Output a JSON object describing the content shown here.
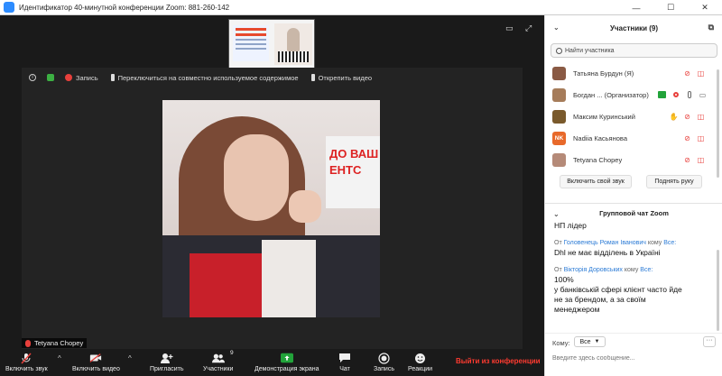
{
  "window": {
    "title": "Идентификатор 40-минутной конференции Zoom: 881-260-142",
    "controls": [
      "—",
      "☐",
      "✕"
    ]
  },
  "video_bar": {
    "record_label": "Запись",
    "switch_label": "Переключиться на совместно используемое содержимое",
    "pin_label": "Открепить видео"
  },
  "thumbnail": {
    "slide_text": "Електронний оборот"
  },
  "video_photo": {
    "sign_line1": "ДО ВАШ",
    "sign_line2": "ЕНТС"
  },
  "name_tag": "Tetyana Chopey",
  "toolbar": {
    "mute": "Включить звук",
    "video": "Включить видео",
    "invite": "Пригласить",
    "participants": "Участники",
    "participants_count": "9",
    "share": "Демонстрация экрана",
    "chat": "Чат",
    "record": "Запись",
    "reactions": "Реакции",
    "end": "Выйти из конференции"
  },
  "sidebar": {
    "participants_header": "Участники (9)",
    "search_placeholder": "Найти участника",
    "participants": [
      {
        "name": "Татьяна Бурдун (Я)",
        "avatar_color": "#8a5a44",
        "avatar_text": ""
      },
      {
        "name": "Богдан ...   (Организатор)",
        "avatar_color": "#a67c5a",
        "avatar_text": ""
      },
      {
        "name": "Максим Куринський",
        "avatar_color": "#7a5a2c",
        "avatar_text": ""
      },
      {
        "name": "Nadiia Касьянова",
        "avatar_color": "#e8692a",
        "avatar_text": "NK"
      },
      {
        "name": "Tetyana Chopey",
        "avatar_color": "#b58a78",
        "avatar_text": ""
      }
    ],
    "unmute_btn": "Включить свой звук",
    "raise_hand_btn": "Поднять руку",
    "chat_header": "Групповой чат Zoom",
    "chat": {
      "m1": "НП лідер",
      "from1_prefix": "От",
      "from1_name": "Головенець Роман Іванович",
      "from1_to": "кому",
      "from1_target": "Все:",
      "m2": "Dhl не має відділень в Україні",
      "from2_prefix": "От",
      "from2_name": "Вікторія Доровських",
      "from2_to": "кому",
      "from2_target": "Все:",
      "m3": "100%",
      "m4": "у банківській сфері клієнт часто йде не за брендом, а за своїм менеджером"
    },
    "to_label": "Кому:",
    "to_value": "Все",
    "message_placeholder": "Введите здесь сообщение..."
  }
}
